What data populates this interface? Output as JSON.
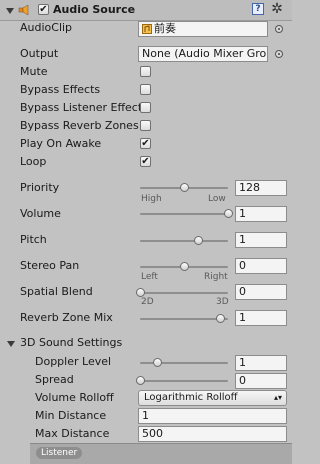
{
  "header": {
    "title": "Audio Source",
    "enabled": "✔",
    "help_icon": "?",
    "settings_icon": "✲"
  },
  "properties": {
    "audio_clip": {
      "label": "AudioClip",
      "value": "前奏"
    },
    "output": {
      "label": "Output",
      "value": "None (Audio Mixer Gro"
    },
    "mute": {
      "label": "Mute",
      "checked": ""
    },
    "bypass_effects": {
      "label": "Bypass Effects",
      "checked": ""
    },
    "bypass_listener_effects": {
      "label": "Bypass Listener Effect",
      "checked": ""
    },
    "bypass_reverb_zones": {
      "label": "Bypass Reverb Zones",
      "checked": ""
    },
    "play_on_awake": {
      "label": "Play On Awake",
      "checked": "✔"
    },
    "loop": {
      "label": "Loop",
      "checked": "✔"
    },
    "priority": {
      "label": "Priority",
      "value": "128",
      "min_label": "High",
      "max_label": "Low",
      "fraction": 0.5
    },
    "volume": {
      "label": "Volume",
      "value": "1",
      "fraction": 1.0
    },
    "pitch": {
      "label": "Pitch",
      "value": "1",
      "fraction": 0.67
    },
    "stereo_pan": {
      "label": "Stereo Pan",
      "value": "0",
      "min_label": "Left",
      "max_label": "Right",
      "fraction": 0.5
    },
    "spatial_blend": {
      "label": "Spatial Blend",
      "value": "0",
      "min_label": "2D",
      "max_label": "3D",
      "fraction": 0.0
    },
    "reverb_zone_mix": {
      "label": "Reverb Zone Mix",
      "value": "1",
      "fraction": 0.91
    }
  },
  "sound3d": {
    "title": "3D Sound Settings",
    "doppler_level": {
      "label": "Doppler Level",
      "value": "1",
      "fraction": 0.2
    },
    "spread": {
      "label": "Spread",
      "value": "0",
      "fraction": 0.0
    },
    "volume_rolloff": {
      "label": "Volume Rolloff",
      "value": "Logarithmic Rolloff"
    },
    "min_distance": {
      "label": "Min Distance",
      "value": "1"
    },
    "max_distance": {
      "label": "Max Distance",
      "value": "500"
    }
  },
  "footer": {
    "listener_label": "Listener"
  },
  "colors": {
    "background": "#c2c2c2",
    "field": "#f4f4f4"
  }
}
